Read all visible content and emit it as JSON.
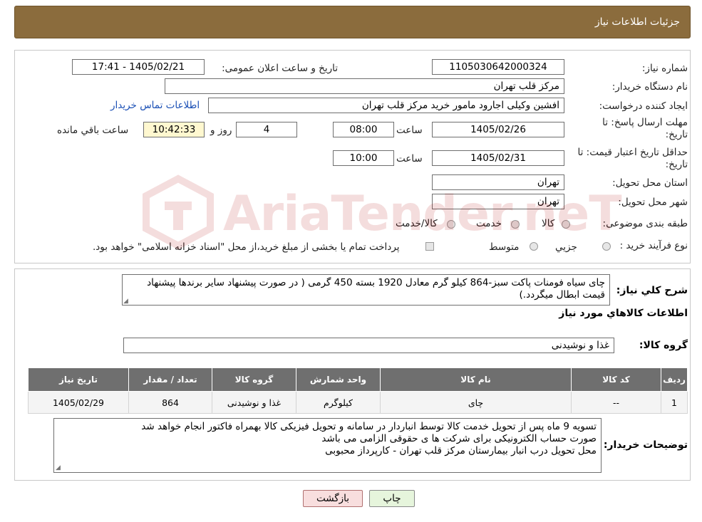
{
  "header": {
    "title": "جزئیات اطلاعات نیاز"
  },
  "form": {
    "need_number_label": "شماره نیاز:",
    "need_number": "1105030642000324",
    "announce_label": "تاریخ و ساعت اعلان عمومی:",
    "announce_value": "1405/02/21 - 17:41",
    "buyer_label": "نام دستگاه خریدار:",
    "buyer": "مرکز قلب تهران",
    "creator_label": "ایجاد کننده درخواست:",
    "creator": "افشین وکیلی اجارود مامور خرید مرکز قلب تهران",
    "contact_link": "اطلاعات تماس خریدار",
    "deadline_label_1": "مهلت ارسال پاسخ: تا",
    "deadline_label_2": "تاریخ:",
    "deadline_date": "1405/02/26",
    "time_label": "ساعت",
    "deadline_time": "08:00",
    "days_value": "4",
    "days_label": "روز و",
    "remaining_value": "10:42:33",
    "remaining_label": "ساعت باقي مانده",
    "validity_label_1": "حداقل تاریخ اعتبار قیمت: تا",
    "validity_label_2": "تاریخ:",
    "validity_date": "1405/02/31",
    "validity_time": "10:00",
    "province_label": "استان محل تحویل:",
    "province": "تهران",
    "city_label": "شهر محل تحویل:",
    "city": "تهران",
    "category_label": "طبقه بندی موضوعی:",
    "category_options": [
      "کالا",
      "خدمت",
      "کالا/خدمت"
    ],
    "process_label": "نوع فرآیند خرید :",
    "process_options": [
      "جزیي",
      "متوسط"
    ],
    "process_note": "پرداخت تمام یا بخشی از مبلغ خرید،از محل \"اسناد خزانه اسلامی\" خواهد بود."
  },
  "description": {
    "label": "شرح کلي نياز:",
    "text": "چای سیاه فومنات پاکت سبز-864  کیلو گرم معادل 1920 بسته 450 گرمی ( در صورت پیشنهاد سایر برندها پیشنهاد قیمت ابطال میگردد.)"
  },
  "goods": {
    "section_title": "اطلاعات کالاهاي مورد نياز",
    "group_label": "گروه کالا:",
    "group_value": "غذا و نوشیدنی",
    "columns": [
      "رديف",
      "کد کالا",
      "نام کالا",
      "واحد شمارش",
      "گروه کالا",
      "تعداد / مقدار",
      "تاریخ نیاز"
    ],
    "rows": [
      [
        "1",
        "--",
        "چای",
        "کیلوگرم",
        "غذا و نوشیدنی",
        "864",
        "1405/02/29"
      ]
    ]
  },
  "buyer_notes": {
    "label": "توضیحات خریدار:",
    "lines": [
      "تسویه 9 ماه پس از تحویل خدمت کالا توسط انباردار در سامانه و تحویل فیزیکی کالا بهمراه فاکتور انجام خواهد شد",
      "صورت حساب الکترونیکی برای شرکت ها ی حقوقی الزامی می باشد",
      "محل تحویل درب انبار بیمارستان مرکز قلب تهران - کارپرداز محبوبی"
    ]
  },
  "buttons": {
    "print": "چاپ",
    "back": "بازگشت"
  },
  "colors": {
    "header_bg": "#8b6c3d",
    "table_header_bg": "#6f6f6f",
    "back_button_bg": "#f8dede"
  },
  "watermark": {
    "text": "AriaTender.neT"
  }
}
